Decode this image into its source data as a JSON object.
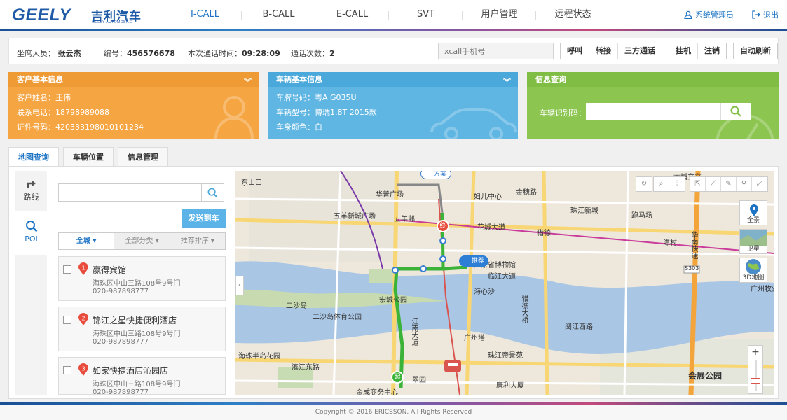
{
  "brand": {
    "name_en": "GEELY",
    "name_cn": "吉利汽车",
    "sub": "GEELY AUTOMOBILE"
  },
  "nav": [
    {
      "label": "I-CALL"
    },
    {
      "label": "B-CALL"
    },
    {
      "label": "E-CALL"
    },
    {
      "label": "SVT"
    },
    {
      "label": "用户管理"
    },
    {
      "label": "远程状态"
    }
  ],
  "header": {
    "user": "系统管理员",
    "logout": "退出"
  },
  "callbar": {
    "agent_label": "坐席人员：",
    "agent": "张云杰",
    "id_label": "编号：",
    "id": "456576678",
    "time_label": "本次通话时间：",
    "time": "09:28:09",
    "count_label": "通话次数：",
    "count": "2",
    "phone_placeholder": "xcall手机号",
    "buttons1": [
      "呼叫",
      "转接",
      "三方通话"
    ],
    "buttons2": [
      "挂机",
      "注销"
    ],
    "refresh": "自动刷新"
  },
  "customer": {
    "title": "客户基本信息",
    "name_label": "客户姓名：",
    "name": "王伟",
    "phone_label": "联系电话：",
    "phone": "18798989088",
    "idno_label": "证件号码：",
    "idno": "420333198010101234"
  },
  "vehicle": {
    "title": "车辆基本信息",
    "plate_label": "车牌号码：",
    "plate": "粤A G035U",
    "model_label": "车辆型号：",
    "model": "博瑞1.8T 2015款",
    "color_label": "车身颜色：",
    "color": "白"
  },
  "query": {
    "title": "信息查询",
    "vin_label": "车辆识别码："
  },
  "tabs": [
    "地图查询",
    "车辆位置",
    "信息管理"
  ],
  "leftnav": {
    "route": "路线",
    "poi": "POI"
  },
  "poi": {
    "send": "发送到车",
    "filters": [
      "全城 ▾",
      "全部分类 ▾",
      "推荐排序 ▾"
    ],
    "items": [
      {
        "num": "1",
        "name": "赢得宾馆",
        "addr": "海珠区中山三路108号9号门",
        "tel": "020-987898777"
      },
      {
        "num": "2",
        "name": "锦江之星快捷便利酒店",
        "addr": "海珠区中山三路108号9号门",
        "tel": "020-987898777"
      },
      {
        "num": "3",
        "name": "如家快捷酒店沁园店",
        "addr": "海珠区中山三路108号9号门",
        "tel": "020-987898777"
      }
    ]
  },
  "map": {
    "labels": [
      "东山口",
      "华普广场",
      "五羊邨",
      "五羊新城广场",
      "妇儿中心",
      "金穗路",
      "花城大道",
      "猎德",
      "潭村",
      "广东省博物馆",
      "临江大道",
      "海心沙",
      "二沙岛",
      "广州塔",
      "珠江帝景苑",
      "海珠半岛花园",
      "金成商务中心",
      "黄埔立交",
      "跑马场",
      "华南快速",
      "会展公园",
      "宏城公园",
      "滨江东路",
      "江南大道",
      "珠江新城",
      "翠园",
      "康利大厦",
      "猎德大桥",
      "阅江西路",
      "二沙岛体育公园",
      "广州牧业"
    ],
    "route_tags": {
      "scheme": "方案",
      "recommend": "推荐",
      "end": "终",
      "start": "起"
    },
    "types": {
      "panorama": "全景",
      "satellite": "卫星",
      "three_d": "3D地图"
    },
    "road_shield": "S303"
  },
  "footer": "Copyright © 2016 ERICSSON. All Rights Reserved",
  "colors": {
    "accent": "#1d74c4",
    "orange": "#f5a542",
    "blue": "#5fb6e3",
    "green": "#8cc54f",
    "route": "#3bb339"
  }
}
